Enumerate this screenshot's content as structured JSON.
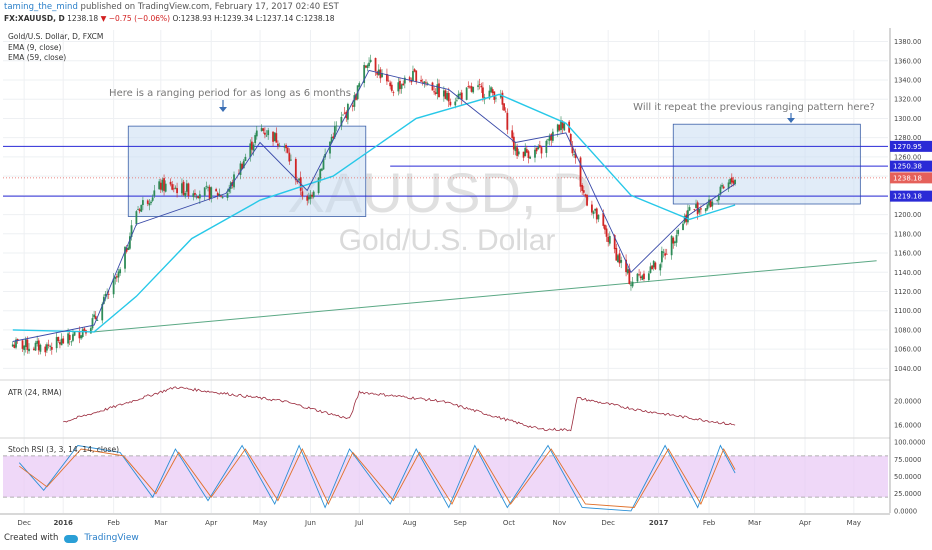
{
  "header": {
    "username": "taming_the_mind",
    "published_text": "published on TradingView.com, February 17, 2017 02:40 EST"
  },
  "symbol_line": {
    "ticker": "FX:XAUUSD, D",
    "price": "1238.18",
    "change": "▼ −0.75 (−0.06%)",
    "ohlc": "O:1238.93 H:1239.34 L:1237.14 C:1238.18"
  },
  "legend": {
    "instrument": "Gold/U.S. Dollar, D, FXCM",
    "ema_fast": "EMA (9, close)",
    "ema_slow": "EMA (59, close)"
  },
  "watermark": {
    "symbol": "XAUUSD, D",
    "name": "Gold/U.S. Dollar"
  },
  "annotations": {
    "left_box_text": "Here is a ranging period for as long as 6 months",
    "right_box_text": "Will it repeat the previous ranging pattern here?"
  },
  "price_badges": [
    {
      "value": "1270.95",
      "color": "#2a2ad6"
    },
    {
      "value": "1250.38",
      "color": "#2a2ad6"
    },
    {
      "value": "1238.18",
      "color": "#e5605a"
    },
    {
      "value": "1219.18",
      "color": "#2a2ad6"
    }
  ],
  "panes": {
    "atr_label": "ATR (24, RMA)",
    "stoch_label": "Stoch RSI (3, 3, 14, 14, close)"
  },
  "footer": {
    "created_with": "Created with",
    "brand": "TradingView"
  },
  "colors": {
    "candle_up": "#2e8b57",
    "candle_down": "#d02525",
    "ema_fast": "#3a4aa8",
    "ema_slow": "#27c8e8",
    "trendline": "#5aa884",
    "atr": "#9b2b3d",
    "stoch_k": "#2a8fd6",
    "stoch_d": "#e0702a",
    "stoch_band": "#e8c8f5",
    "range_box": "#c8dcf2"
  },
  "chart_data": [
    {
      "type": "candlestick",
      "title": "Gold/U.S. Dollar, D, FXCM",
      "x_ticks": [
        "Dec",
        "2016",
        "Feb",
        "Mar",
        "Apr",
        "May",
        "Jun",
        "Jul",
        "Aug",
        "Sep",
        "Oct",
        "Nov",
        "Dec",
        "2017",
        "Feb",
        "Mar",
        "Apr",
        "May"
      ],
      "y_ticks": [
        "1040.00",
        "1060.00",
        "1080.00",
        "1100.00",
        "1120.00",
        "1140.00",
        "1160.00",
        "1180.00",
        "1200.00",
        "1220.00",
        "1240.00",
        "1260.00",
        "1280.00",
        "1300.00",
        "1320.00",
        "1340.00",
        "1360.00",
        "1380.00"
      ],
      "ylim": [
        1030,
        1392
      ],
      "price_path": [
        {
          "date": "2015-12-01",
          "price": 1065
        },
        {
          "date": "2015-12-20",
          "price": 1062
        },
        {
          "date": "2016-01-05",
          "price": 1070
        },
        {
          "date": "2016-01-20",
          "price": 1090
        },
        {
          "date": "2016-02-05",
          "price": 1140
        },
        {
          "date": "2016-02-15",
          "price": 1205
        },
        {
          "date": "2016-03-01",
          "price": 1230
        },
        {
          "date": "2016-03-20",
          "price": 1225
        },
        {
          "date": "2016-04-10",
          "price": 1220
        },
        {
          "date": "2016-05-01",
          "price": 1290
        },
        {
          "date": "2016-05-15",
          "price": 1275
        },
        {
          "date": "2016-05-30",
          "price": 1210
        },
        {
          "date": "2016-06-15",
          "price": 1285
        },
        {
          "date": "2016-06-28",
          "price": 1320
        },
        {
          "date": "2016-07-07",
          "price": 1365
        },
        {
          "date": "2016-07-20",
          "price": 1330
        },
        {
          "date": "2016-08-05",
          "price": 1345
        },
        {
          "date": "2016-08-25",
          "price": 1320
        },
        {
          "date": "2016-09-10",
          "price": 1330
        },
        {
          "date": "2016-09-25",
          "price": 1325
        },
        {
          "date": "2016-10-05",
          "price": 1265
        },
        {
          "date": "2016-10-20",
          "price": 1265
        },
        {
          "date": "2016-11-05",
          "price": 1300
        },
        {
          "date": "2016-11-15",
          "price": 1225
        },
        {
          "date": "2016-12-01",
          "price": 1175
        },
        {
          "date": "2016-12-15",
          "price": 1130
        },
        {
          "date": "2017-01-01",
          "price": 1150
        },
        {
          "date": "2017-01-20",
          "price": 1205
        },
        {
          "date": "2017-02-01",
          "price": 1210
        },
        {
          "date": "2017-02-17",
          "price": 1238
        }
      ],
      "ema_9_path": [
        {
          "date": "2015-12-01",
          "price": 1068
        },
        {
          "date": "2016-01-20",
          "price": 1085
        },
        {
          "date": "2016-02-15",
          "price": 1190
        },
        {
          "date": "2016-04-10",
          "price": 1222
        },
        {
          "date": "2016-05-01",
          "price": 1275
        },
        {
          "date": "2016-05-30",
          "price": 1225
        },
        {
          "date": "2016-07-07",
          "price": 1350
        },
        {
          "date": "2016-08-25",
          "price": 1330
        },
        {
          "date": "2016-10-05",
          "price": 1275
        },
        {
          "date": "2016-11-05",
          "price": 1285
        },
        {
          "date": "2016-12-15",
          "price": 1140
        },
        {
          "date": "2017-01-20",
          "price": 1200
        },
        {
          "date": "2017-02-17",
          "price": 1232
        }
      ],
      "ema_59_path": [
        {
          "date": "2015-12-01",
          "price": 1080
        },
        {
          "date": "2016-01-20",
          "price": 1078
        },
        {
          "date": "2016-02-15",
          "price": 1115
        },
        {
          "date": "2016-03-20",
          "price": 1175
        },
        {
          "date": "2016-05-01",
          "price": 1215
        },
        {
          "date": "2016-06-15",
          "price": 1240
        },
        {
          "date": "2016-08-05",
          "price": 1300
        },
        {
          "date": "2016-09-25",
          "price": 1325
        },
        {
          "date": "2016-11-05",
          "price": 1295
        },
        {
          "date": "2016-12-15",
          "price": 1220
        },
        {
          "date": "2017-01-20",
          "price": 1195
        },
        {
          "date": "2017-02-17",
          "price": 1210
        }
      ],
      "trendline": [
        {
          "date": "2016-01-20",
          "price": 1078
        },
        {
          "date": "2017-05-15",
          "price": 1152
        }
      ],
      "horizontal_levels": [
        1270.95,
        1250.38,
        1238.18,
        1219.18
      ],
      "range_boxes": [
        {
          "x_start": "2016-02-10",
          "x_end": "2016-07-05",
          "y_low": 1198,
          "y_high": 1292
        },
        {
          "x_start": "2017-01-10",
          "x_end": "2017-05-05",
          "y_low": 1211,
          "y_high": 1294
        }
      ]
    },
    {
      "type": "line",
      "title": "ATR (24, RMA)",
      "y_ticks": [
        "16.0000",
        "20.0000"
      ],
      "ylim": [
        14,
        23
      ],
      "series": [
        {
          "name": "ATR (24, RMA)",
          "points": [
            {
              "date": "2016-01-01",
              "value": 16.5
            },
            {
              "date": "2016-02-01",
              "value": 19.0
            },
            {
              "date": "2016-03-10",
              "value": 22.3
            },
            {
              "date": "2016-05-15",
              "value": 20.0
            },
            {
              "date": "2016-06-25",
              "value": 17.0
            },
            {
              "date": "2016-07-01",
              "value": 21.5
            },
            {
              "date": "2016-08-20",
              "value": 20.0
            },
            {
              "date": "2016-10-20",
              "value": 15.3
            },
            {
              "date": "2016-11-08",
              "value": 15.2
            },
            {
              "date": "2016-11-12",
              "value": 20.5
            },
            {
              "date": "2016-12-20",
              "value": 18.5
            },
            {
              "date": "2017-02-17",
              "value": 16.0
            }
          ]
        }
      ]
    },
    {
      "type": "line",
      "title": "Stoch RSI (3, 3, 14, 14, close)",
      "y_ticks": [
        "0.0000",
        "25.0000",
        "50.0000",
        "75.0000",
        "100.0000"
      ],
      "ylim": [
        -3,
        103
      ],
      "band": [
        20,
        80
      ],
      "series": [
        {
          "name": "K",
          "points": [
            {
              "date": "2015-12-05",
              "value": 70
            },
            {
              "date": "2015-12-20",
              "value": 30
            },
            {
              "date": "2016-01-10",
              "value": 95
            },
            {
              "date": "2016-02-05",
              "value": 85
            },
            {
              "date": "2016-02-25",
              "value": 20
            },
            {
              "date": "2016-03-10",
              "value": 90
            },
            {
              "date": "2016-03-30",
              "value": 15
            },
            {
              "date": "2016-04-20",
              "value": 95
            },
            {
              "date": "2016-05-10",
              "value": 10
            },
            {
              "date": "2016-05-25",
              "value": 95
            },
            {
              "date": "2016-06-10",
              "value": 5
            },
            {
              "date": "2016-06-25",
              "value": 90
            },
            {
              "date": "2016-07-20",
              "value": 10
            },
            {
              "date": "2016-08-05",
              "value": 90
            },
            {
              "date": "2016-08-25",
              "value": 5
            },
            {
              "date": "2016-09-10",
              "value": 95
            },
            {
              "date": "2016-09-30",
              "value": 5
            },
            {
              "date": "2016-10-25",
              "value": 95
            },
            {
              "date": "2016-11-15",
              "value": 5
            },
            {
              "date": "2016-12-15",
              "value": 0
            },
            {
              "date": "2017-01-05",
              "value": 95
            },
            {
              "date": "2017-01-25",
              "value": 5
            },
            {
              "date": "2017-02-08",
              "value": 95
            },
            {
              "date": "2017-02-17",
              "value": 55
            }
          ]
        },
        {
          "name": "D",
          "points": [
            {
              "date": "2015-12-05",
              "value": 65
            },
            {
              "date": "2015-12-22",
              "value": 35
            },
            {
              "date": "2016-01-12",
              "value": 90
            },
            {
              "date": "2016-02-07",
              "value": 80
            },
            {
              "date": "2016-02-27",
              "value": 25
            },
            {
              "date": "2016-03-12",
              "value": 85
            },
            {
              "date": "2016-04-01",
              "value": 20
            },
            {
              "date": "2016-04-22",
              "value": 90
            },
            {
              "date": "2016-05-12",
              "value": 15
            },
            {
              "date": "2016-05-27",
              "value": 90
            },
            {
              "date": "2016-06-12",
              "value": 10
            },
            {
              "date": "2016-06-27",
              "value": 85
            },
            {
              "date": "2016-07-22",
              "value": 15
            },
            {
              "date": "2016-08-07",
              "value": 85
            },
            {
              "date": "2016-08-27",
              "value": 10
            },
            {
              "date": "2016-09-12",
              "value": 90
            },
            {
              "date": "2016-10-02",
              "value": 10
            },
            {
              "date": "2016-10-27",
              "value": 90
            },
            {
              "date": "2016-11-17",
              "value": 10
            },
            {
              "date": "2016-12-17",
              "value": 5
            },
            {
              "date": "2017-01-07",
              "value": 90
            },
            {
              "date": "2017-01-27",
              "value": 10
            },
            {
              "date": "2017-02-10",
              "value": 90
            },
            {
              "date": "2017-02-17",
              "value": 60
            }
          ]
        }
      ]
    }
  ]
}
